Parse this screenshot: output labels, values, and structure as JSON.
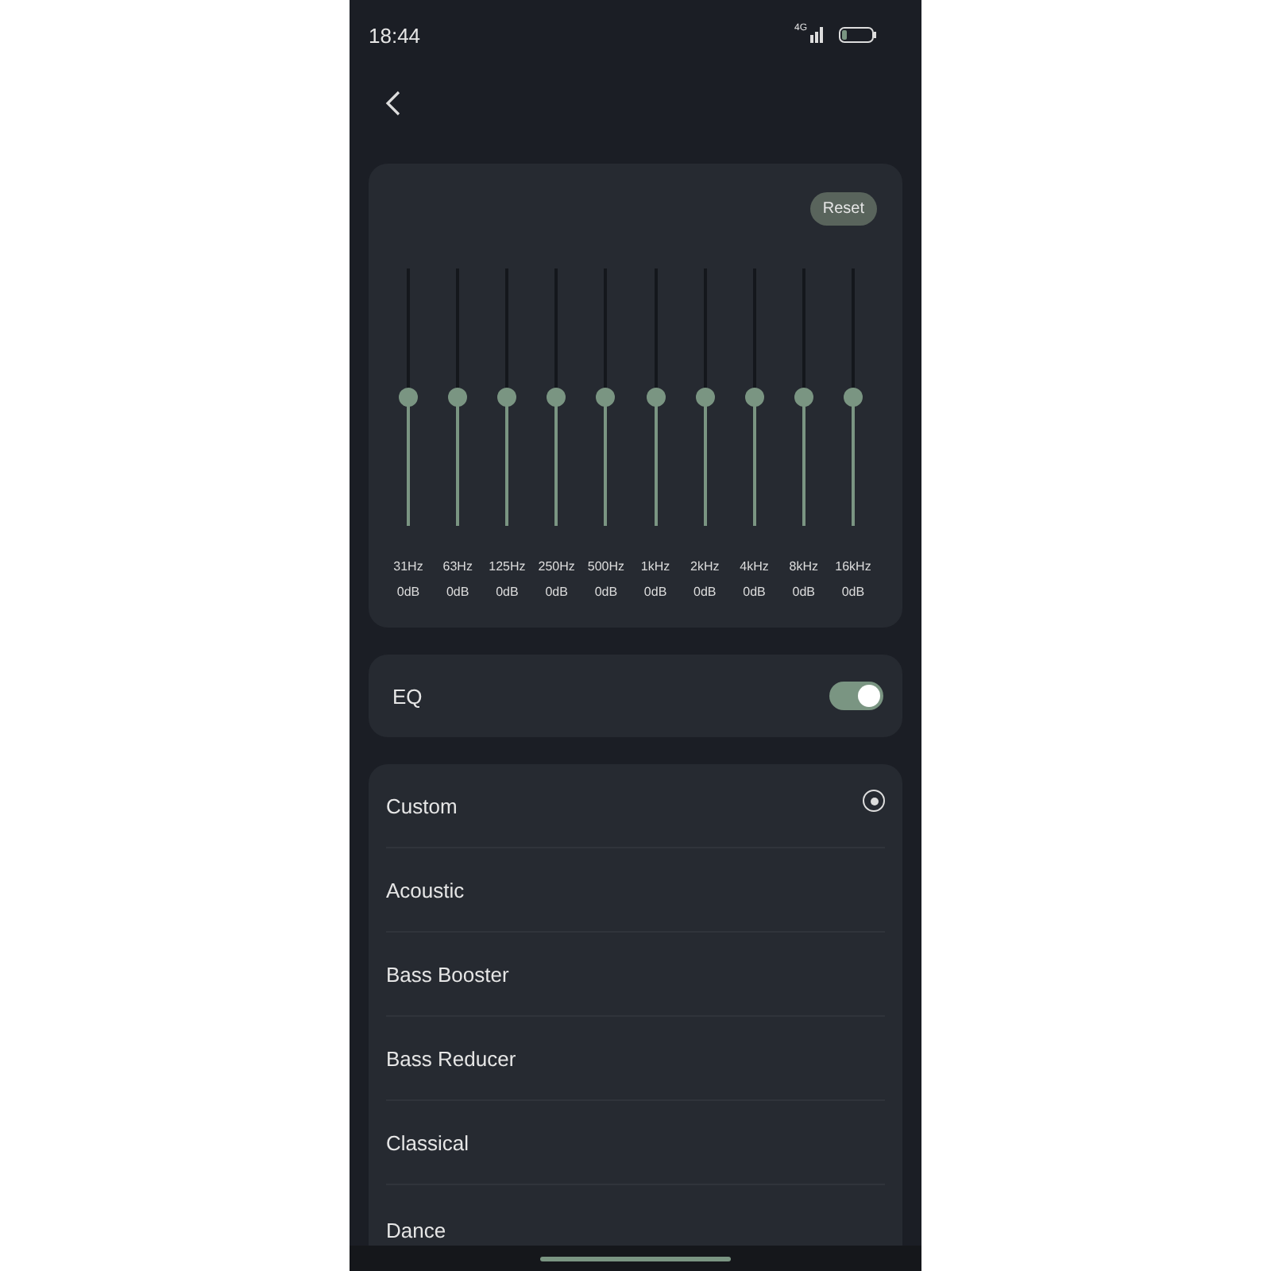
{
  "status_bar": {
    "time": "18:44",
    "network": "4G"
  },
  "equalizer": {
    "reset_label": "Reset",
    "bands": [
      {
        "frequency": "31Hz",
        "gain": "0dB",
        "level": 0.5
      },
      {
        "frequency": "63Hz",
        "gain": "0dB",
        "level": 0.5
      },
      {
        "frequency": "125Hz",
        "gain": "0dB",
        "level": 0.5
      },
      {
        "frequency": "250Hz",
        "gain": "0dB",
        "level": 0.5
      },
      {
        "frequency": "500Hz",
        "gain": "0dB",
        "level": 0.5
      },
      {
        "frequency": "1kHz",
        "gain": "0dB",
        "level": 0.5
      },
      {
        "frequency": "2kHz",
        "gain": "0dB",
        "level": 0.5
      },
      {
        "frequency": "4kHz",
        "gain": "0dB",
        "level": 0.5
      },
      {
        "frequency": "8kHz",
        "gain": "0dB",
        "level": 0.5
      },
      {
        "frequency": "16kHz",
        "gain": "0dB",
        "level": 0.5
      }
    ]
  },
  "eq_toggle": {
    "label": "EQ",
    "on": true
  },
  "presets": [
    {
      "label": "Custom",
      "selected": true
    },
    {
      "label": "Acoustic",
      "selected": false
    },
    {
      "label": "Bass Booster",
      "selected": false
    },
    {
      "label": "Bass Reducer",
      "selected": false
    },
    {
      "label": "Classical",
      "selected": false
    },
    {
      "label": "Dance",
      "selected": false
    }
  ]
}
